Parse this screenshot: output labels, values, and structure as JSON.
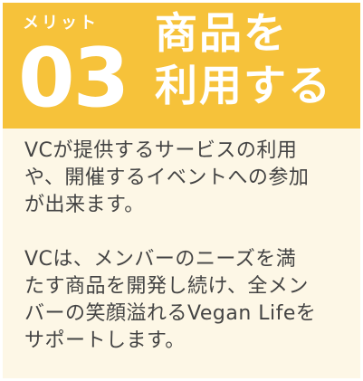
{
  "card": {
    "merit_label": "メリット",
    "merit_number": "03",
    "title_lines": [
      "商品を",
      "利用する"
    ],
    "paragraphs": [
      [
        "VCが提供するサービスの利用",
        "や、開催するイベントへの参加",
        "が出来ます。"
      ],
      [
        "VCは、メンバーのニーズを満",
        "たす商品を開発し続け、全メン",
        "バーの笑顔溢れるVegan Lifeを",
        "サポートします。"
      ]
    ]
  },
  "colors": {
    "header_background": "#f6c23a",
    "card_background": "#fdf7e6",
    "body_text": "#444444",
    "header_text": "#ffffff"
  }
}
